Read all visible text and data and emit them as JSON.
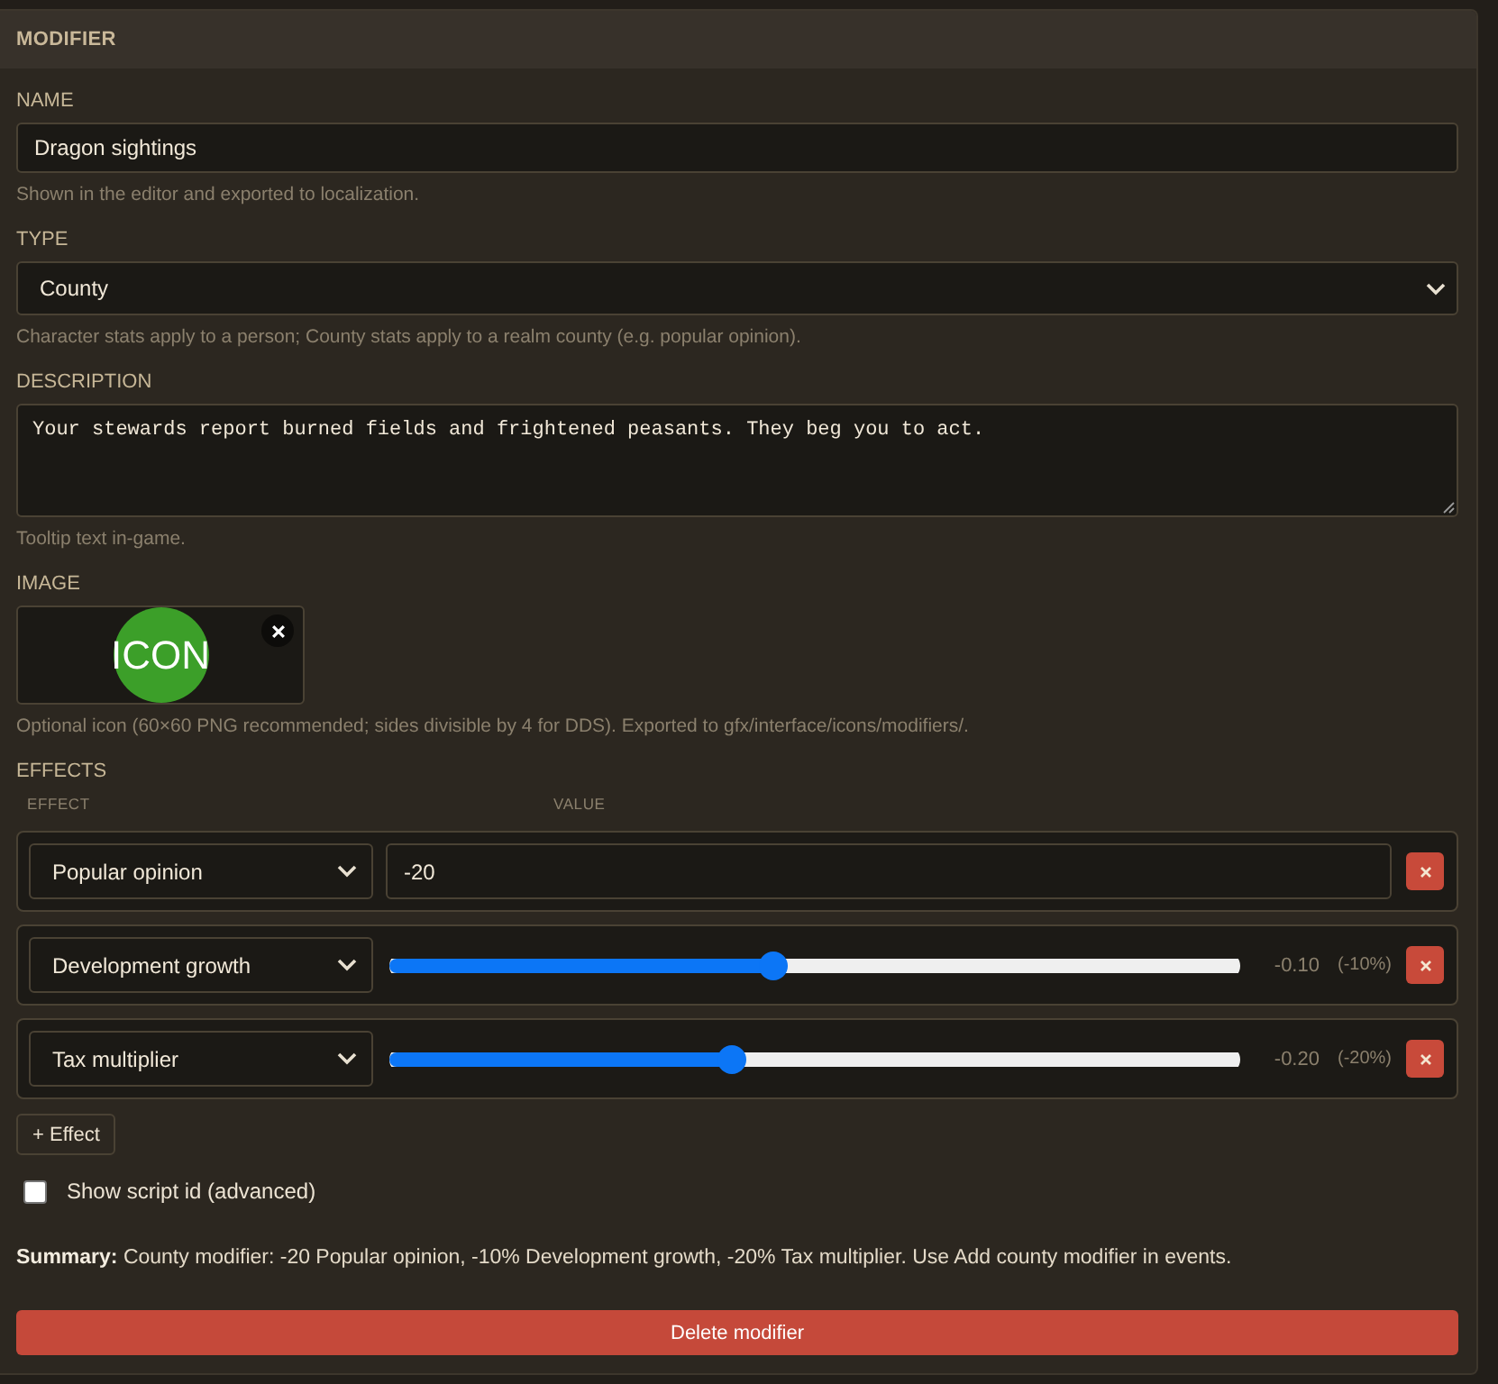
{
  "panel": {
    "title": "MODIFIER"
  },
  "fields": [
    {
      "kind": "text",
      "label": "NAME",
      "value": "Dragon sightings",
      "hint": "Shown in the editor and exported to localization."
    },
    {
      "kind": "select",
      "label": "TYPE",
      "value": "County",
      "hint": "Character stats apply to a person; County stats apply to a realm county (e.g. popular opinion)."
    },
    {
      "kind": "textarea",
      "label": "DESCRIPTION",
      "value": "Your stewards report burned fields and frightened peasants. They beg you to act.",
      "hint": "Tooltip text in-game."
    },
    {
      "kind": "image",
      "label": "IMAGE",
      "image_text": "ICON",
      "hint": "Optional icon (60×60 PNG recommended; sides divisible by 4 for DDS). Exported to gfx/interface/icons/modifiers/."
    }
  ],
  "effects": {
    "label": "EFFECTS",
    "columns": [
      "EFFECT",
      "VALUE"
    ],
    "rows": [
      {
        "kind": "number",
        "effect": "Popular opinion",
        "value": "-20"
      },
      {
        "kind": "slider",
        "effect": "Development growth",
        "level": 0.45,
        "reading": "-0.10",
        "percent": "(-10%)"
      },
      {
        "kind": "slider",
        "effect": "Tax multiplier",
        "level": 0.4,
        "reading": "-0.20",
        "percent": "(-20%)"
      }
    ],
    "add_button": "+ Effect"
  },
  "script_id": {
    "label": "Show script id (advanced)",
    "checked": false
  },
  "summary": "**Summary:** County modifier: -20 Popular opinion, -10% Development growth, -20% Tax multiplier. Use Add county modifier in events.",
  "delete_button": "Delete modifier"
}
